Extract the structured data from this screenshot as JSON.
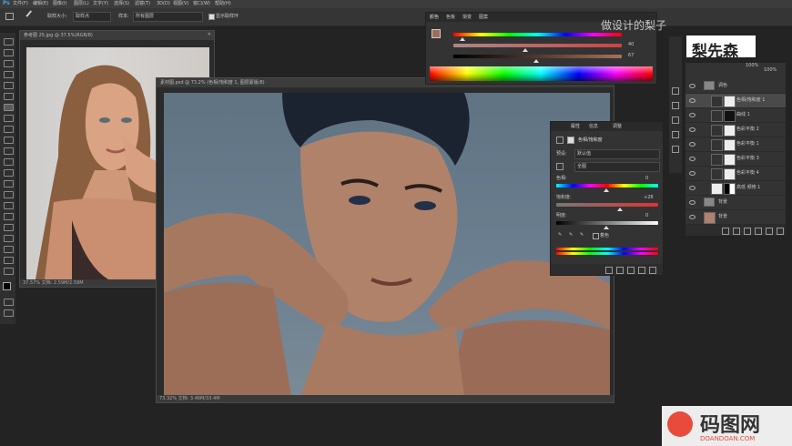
{
  "menu": [
    "文件(F)",
    "编辑(E)",
    "图像(I)",
    "图层(L)",
    "文字(Y)",
    "选择(S)",
    "滤镜(T)",
    "3D(D)",
    "视图(V)",
    "窗口(W)",
    "帮助(H)"
  ],
  "options": {
    "size_label": "取样大小:",
    "size_value": "取样点",
    "sample_label": "样本:",
    "sample_value": "所有图层",
    "ring_label": "显示取样环"
  },
  "watermark_top": "做设计的梨子",
  "logo_text": "梨先森",
  "doc1": {
    "tab": "参考图 25.jpg @ 37.5%(RGB/8)",
    "status": "37.57%   文档: 2.59M/2.59M"
  },
  "doc2": {
    "tab": "素材图.psd @ 73.2% (色相/饱和度 1, 图层蒙版/8)",
    "status": "73.32%   文档: 3.46M/33.4M"
  },
  "color_panel": {
    "tabs": [
      "颜色",
      "色板",
      "渐变",
      "图案"
    ],
    "r_value": "40",
    "g_value": "67"
  },
  "props_panel": {
    "tabs": [
      "属性",
      "信息",
      "调整"
    ],
    "title": "色相/饱和度",
    "preset_label": "预设:",
    "preset_value": "默认值",
    "channel_value": "全图",
    "hue_label": "色相:",
    "hue_value": "0",
    "sat_label": "饱和度:",
    "sat_value": "+28",
    "light_label": "明度:",
    "light_value": "0",
    "colorize_label": "着色"
  },
  "layers_panel": {
    "tabs": [
      "图层",
      "通道",
      "路径"
    ],
    "opacity": "100%",
    "fill": "100%",
    "layers": [
      {
        "name": "调色",
        "type": "group"
      },
      {
        "name": "色相/饱和度 1",
        "type": "adj"
      },
      {
        "name": "曲线 1",
        "type": "adj"
      },
      {
        "name": "色彩平衡 2",
        "type": "adj"
      },
      {
        "name": "色彩平衡 1",
        "type": "adj"
      },
      {
        "name": "色彩平衡 3",
        "type": "adj"
      },
      {
        "name": "色彩平衡 4",
        "type": "adj"
      },
      {
        "name": "高低 频修 1",
        "type": "adj"
      },
      {
        "name": "背景",
        "type": "group"
      },
      {
        "name": "背景",
        "type": "img"
      }
    ]
  },
  "brand": {
    "name": "码图网",
    "domain": "DOANDOAN.COM"
  }
}
